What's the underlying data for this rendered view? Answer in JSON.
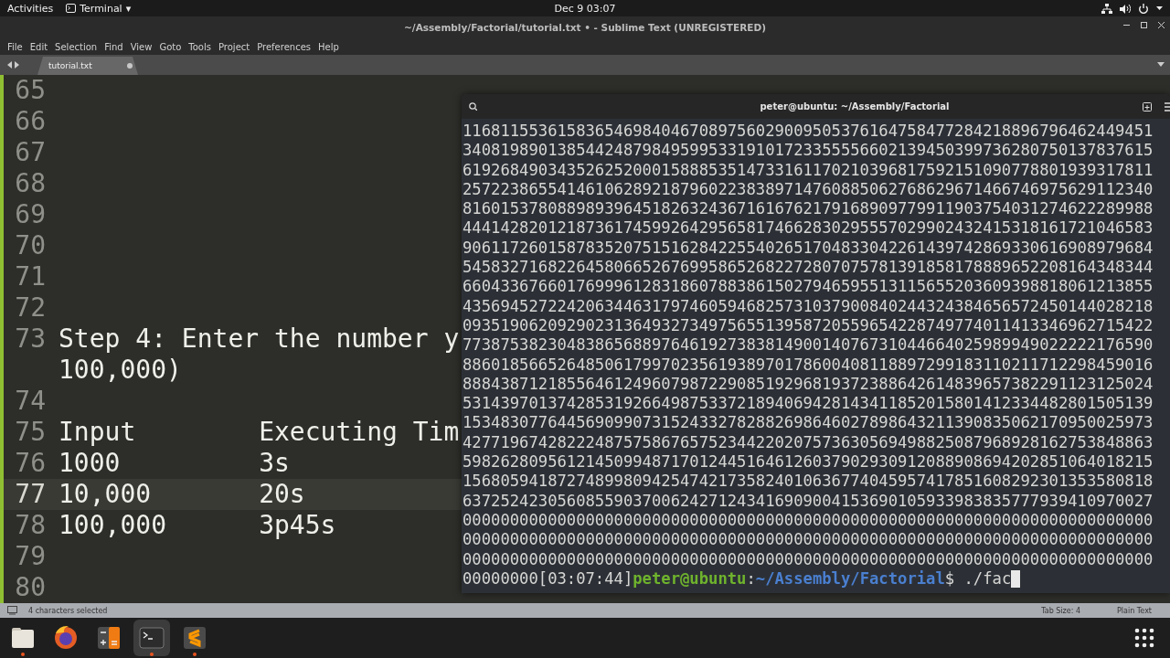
{
  "top_bar": {
    "activities": "Activities",
    "app_menu": "Terminal",
    "app_caret": "▾",
    "clock": "Dec 9  03:07"
  },
  "window": {
    "title": "~/Assembly/Factorial/tutorial.txt • - Sublime Text (UNREGISTERED)"
  },
  "menu": [
    "File",
    "Edit",
    "Selection",
    "Find",
    "View",
    "Goto",
    "Tools",
    "Project",
    "Preferences",
    "Help"
  ],
  "tabs": [
    {
      "label": "tutorial.txt",
      "modified": true
    }
  ],
  "editor": {
    "lines": [
      {
        "number": "65",
        "current": false
      },
      {
        "number": "66",
        "current": false
      },
      {
        "number": "67",
        "current": false
      },
      {
        "number": "68",
        "current": false
      },
      {
        "number": "69",
        "current": false
      },
      {
        "number": "70",
        "current": false
      },
      {
        "number": "71",
        "current": false
      },
      {
        "number": "72",
        "current": false
      },
      {
        "number": "73",
        "text": "Step 4: Enter the number y",
        "wrap": "100,000)",
        "current": false
      },
      {
        "number": "74",
        "current": false
      },
      {
        "number": "75",
        "text": "Input        Executing Tim",
        "current": false
      },
      {
        "number": "76",
        "text": "1000         3s",
        "current": false
      },
      {
        "number": "77",
        "text": "10,000       20s",
        "current": true
      },
      {
        "number": "78",
        "text": "100,000      3p45s",
        "current": false
      },
      {
        "number": "79",
        "current": false
      },
      {
        "number": "80",
        "current": false
      }
    ]
  },
  "status_bar": {
    "selection": "4 characters selected",
    "tab_size": "Tab Size: 4",
    "syntax": "Plain Text"
  },
  "terminal": {
    "title": "peter@ubuntu: ~/Assembly/Factorial",
    "lines": [
      "1168115536158365469840467089756029009505376164758477284218896796462449451",
      "3408198901385442487984959953319101723355556602139450399736280750137837615",
      "6192684903435262520001588853514733161170210396817592151090778801939317811",
      "2572238655414610628921879602238389714760885062768629671466746975629112340",
      "8160153780889893964518263243671616762179168909779911903754031274622289988",
      "4441428201218736174599264295658174662830295557029902432415318161721046583",
      "9061172601587835207515162842255402651704833042261439742869330616908979684",
      "5458327168226458066526769958652682272807075781391858178889652208164348344",
      "6604336766017699961283186078838615027946595513115655203609398818061213855",
      "4356945272242063446317974605946825731037900840244324384656572450144028218",
      "0935190620929023136493273497565513958720559654228749774011413346962715422",
      "7738753823048386568897646192738381490014076731044664025989949022222176590",
      "8860185665264850617997023561938970178600408118897299183110211712298459016",
      "8884387121855646124960798722908519296819372388642614839657382291123125024",
      "5314397013742853192664987533721894069428143411852015801412334482801505139",
      "1534830776445690990731524332782882698646027898643211390835062170950025973",
      "4277196742822248757586765752344220207573630569498825087968928162753848863",
      "5982628095612145099487170124451646126037902930912088908694202851064018215",
      "1568059418727489980942547421735824010636774045957417851608292301353580818",
      "6372524230560855903700624271243416909004153690105933983835777939410970027",
      "0000000000000000000000000000000000000000000000000000000000000000000000000",
      "0000000000000000000000000000000000000000000000000000000000000000000000000",
      "0000000000000000000000000000000000000000000000000000000000000000000000000"
    ],
    "prompt": {
      "output": "00000000[03:07:44]",
      "user": "peter@ubuntu",
      "separator": ":",
      "path": "~/Assembly/Factorial",
      "symbol": "$",
      "command": "./fac"
    }
  },
  "dock": [
    {
      "kind": "files",
      "running": true,
      "selected": false
    },
    {
      "kind": "browser",
      "running": false,
      "selected": false
    },
    {
      "kind": "calculator",
      "running": false,
      "selected": false
    },
    {
      "kind": "terminal",
      "running": true,
      "selected": true
    },
    {
      "kind": "editor",
      "running": true,
      "selected": false
    }
  ]
}
